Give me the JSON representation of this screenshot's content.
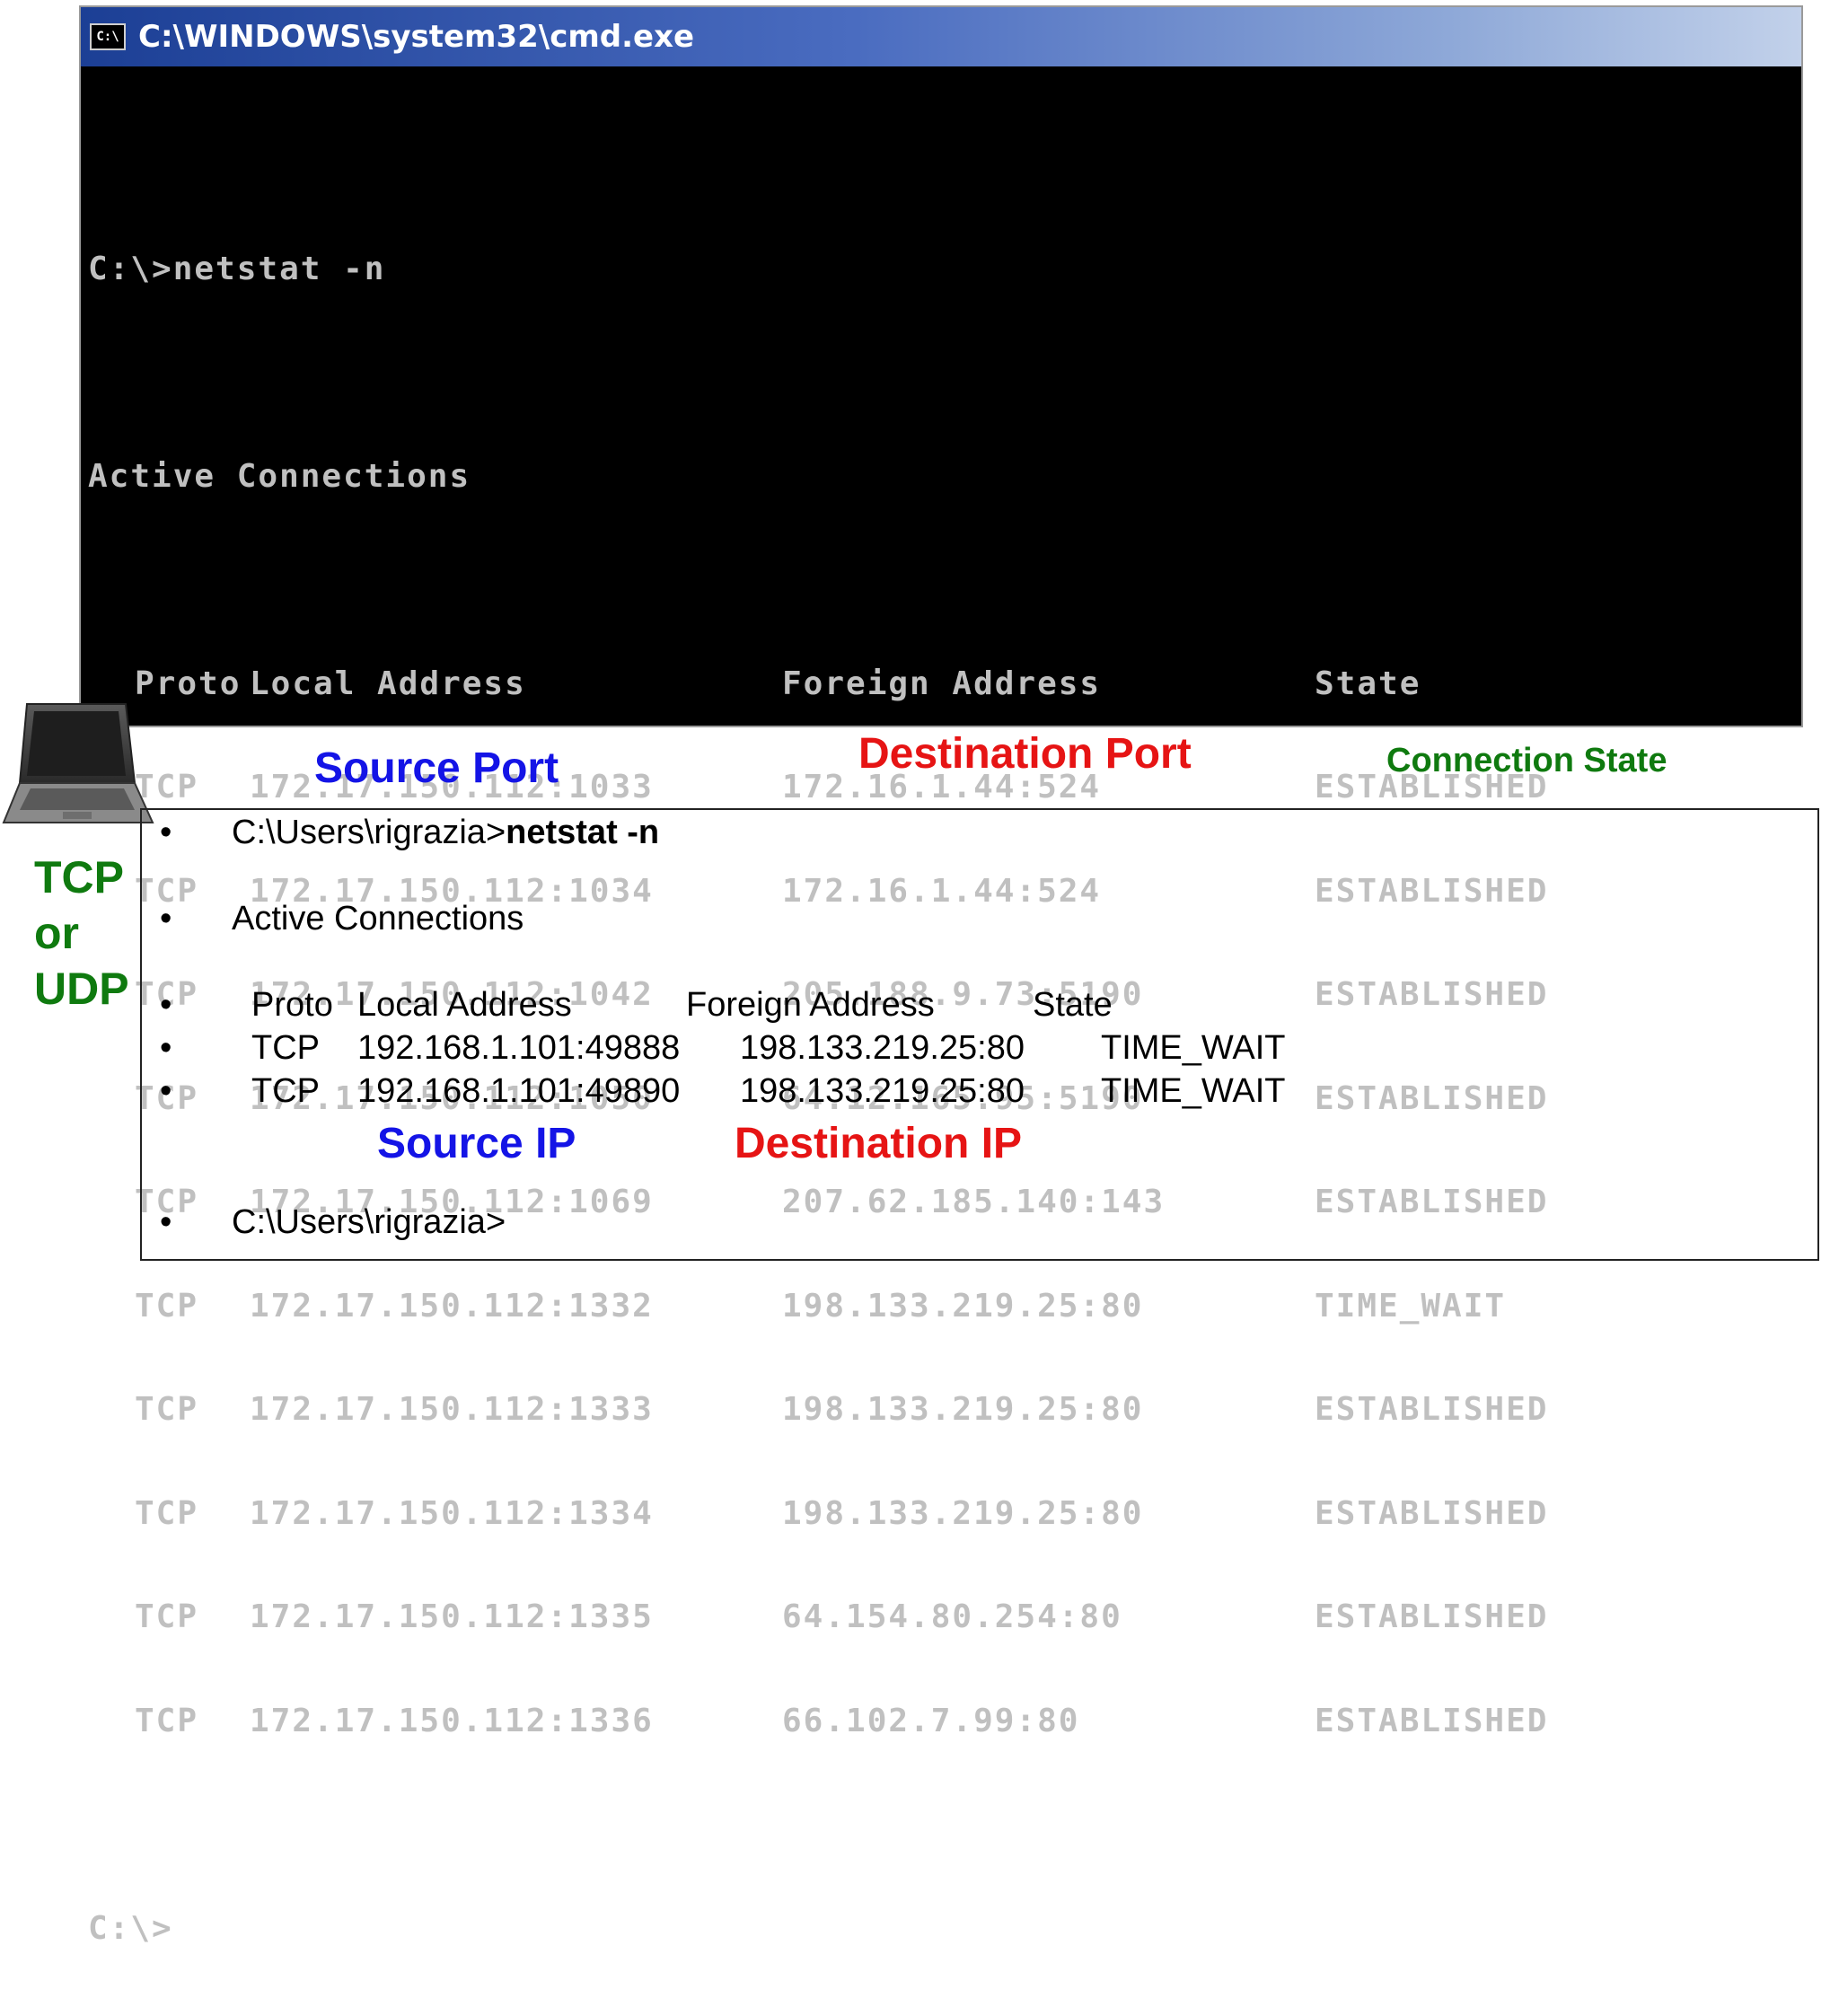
{
  "window": {
    "title": "C:\\WINDOWS\\system32\\cmd.exe",
    "icon_text": "C:\\",
    "icon_name": "cmd-app-icon"
  },
  "console": {
    "command_line": "C:\\>netstat -n",
    "section_title": "Active Connections",
    "headers": [
      "Proto",
      "Local Address",
      "Foreign Address",
      "State"
    ],
    "rows": [
      [
        "TCP",
        "172.17.150.112:1033",
        "172.16.1.44:524",
        "ESTABLISHED"
      ],
      [
        "TCP",
        "172.17.150.112:1034",
        "172.16.1.44:524",
        "ESTABLISHED"
      ],
      [
        "TCP",
        "172.17.150.112:1042",
        "205.188.9.73:5190",
        "ESTABLISHED"
      ],
      [
        "TCP",
        "172.17.150.112:1050",
        "64.12.165.95:5190",
        "ESTABLISHED"
      ],
      [
        "TCP",
        "172.17.150.112:1069",
        "207.62.185.140:143",
        "ESTABLISHED"
      ],
      [
        "TCP",
        "172.17.150.112:1332",
        "198.133.219.25:80",
        "TIME_WAIT"
      ],
      [
        "TCP",
        "172.17.150.112:1333",
        "198.133.219.25:80",
        "ESTABLISHED"
      ],
      [
        "TCP",
        "172.17.150.112:1334",
        "198.133.219.25:80",
        "ESTABLISHED"
      ],
      [
        "TCP",
        "172.17.150.112:1335",
        "64.154.80.254:80",
        "ESTABLISHED"
      ],
      [
        "TCP",
        "172.17.150.112:1336",
        "66.102.7.99:80",
        "ESTABLISHED"
      ]
    ],
    "prompt": "C:\\>"
  },
  "labels": {
    "source_port": "Source Port",
    "destination_port": "Destination Port",
    "connection_state": "Connection State",
    "protocol": [
      "TCP",
      "or",
      "UDP"
    ],
    "source_ip": "Source IP",
    "destination_ip": "Destination IP"
  },
  "transcript": {
    "bullet": "•",
    "prompt_prefix": "C:\\Users\\rigrazia>",
    "command": "netstat -n",
    "section_title": "Active Connections",
    "headers": [
      "Proto",
      "Local Address",
      "Foreign Address",
      "State"
    ],
    "rows": [
      [
        "TCP",
        "192.168.1.101:49888",
        "198.133.219.25:80",
        "TIME_WAIT"
      ],
      [
        "TCP",
        "192.168.1.101:49890",
        "198.133.219.25:80",
        "TIME_WAIT"
      ]
    ],
    "final_prompt": "C:\\Users\\rigrazia>"
  },
  "colors": {
    "source": "#1414e6",
    "destination": "#e61414",
    "state": "#0f7a0f",
    "console_text": "#c0c0c0",
    "console_bg": "#000000",
    "title_bar": "#1c3f95"
  }
}
